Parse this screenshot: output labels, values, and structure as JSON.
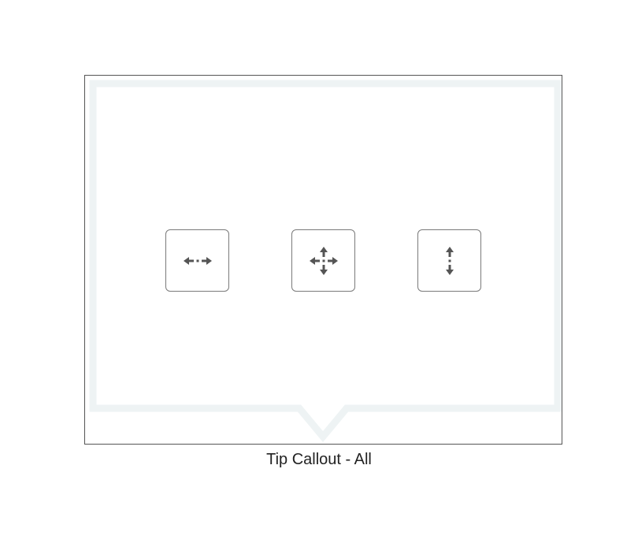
{
  "caption": "Tip Callout - All",
  "colors": {
    "callout_outline": "#eef3f4",
    "frame_border": "#555555",
    "handle_border": "#7a7a7a",
    "icon": "#555555"
  },
  "handles": [
    {
      "icon": "horizontal-resize-icon",
      "direction": "horizontal"
    },
    {
      "icon": "move-all-icon",
      "direction": "all"
    },
    {
      "icon": "vertical-resize-icon",
      "direction": "vertical"
    }
  ]
}
